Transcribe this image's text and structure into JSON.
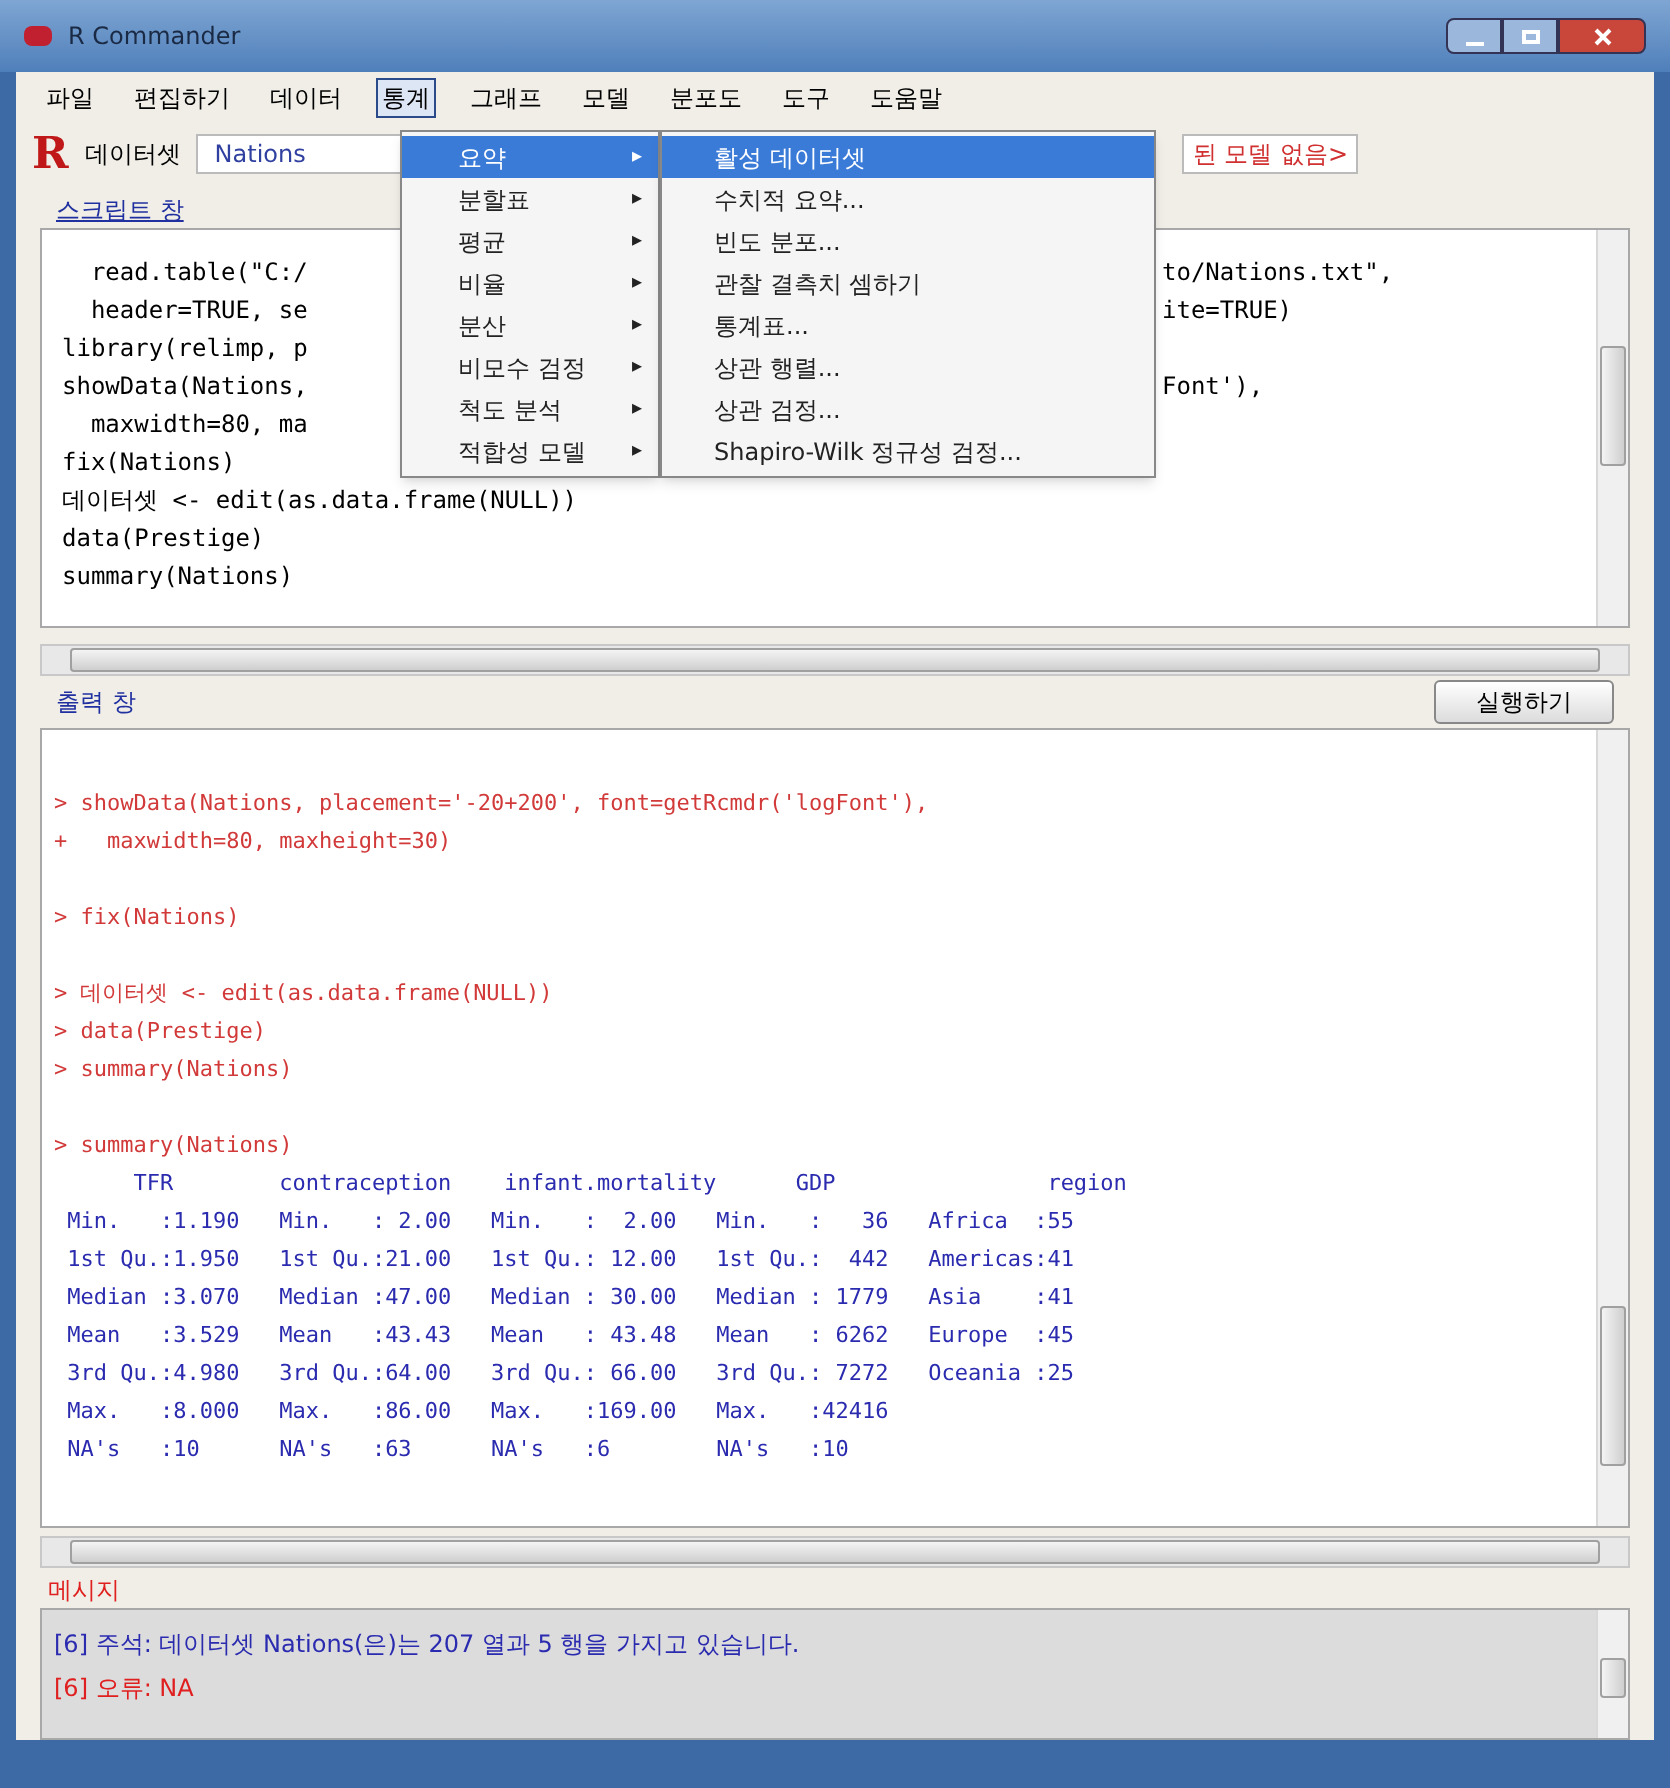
{
  "window": {
    "title": "R Commander"
  },
  "menubar": [
    {
      "label": "파일",
      "selected": false
    },
    {
      "label": "편집하기",
      "selected": false
    },
    {
      "label": "데이터",
      "selected": false
    },
    {
      "label": "통계",
      "selected": true
    },
    {
      "label": "그래프",
      "selected": false
    },
    {
      "label": "모델",
      "selected": false
    },
    {
      "label": "분포도",
      "selected": false
    },
    {
      "label": "도구",
      "selected": false
    },
    {
      "label": "도움말",
      "selected": false
    }
  ],
  "toolbar": {
    "logo": "R",
    "dataset_label": "데이터셋",
    "dataset": "Nations",
    "model": "된 모델 없음>"
  },
  "stats_menu": [
    {
      "label": "요약",
      "selected": true
    },
    {
      "label": "분할표",
      "selected": false
    },
    {
      "label": "평균",
      "selected": false
    },
    {
      "label": "비율",
      "selected": false
    },
    {
      "label": "분산",
      "selected": false
    },
    {
      "label": "비모수 검정",
      "selected": false
    },
    {
      "label": "척도 분석",
      "selected": false
    },
    {
      "label": "적합성 모델",
      "selected": false
    }
  ],
  "submenu_arrow": "▸",
  "summary_menu": [
    {
      "label": "활성 데이터셋",
      "selected": true
    },
    {
      "label": "수치적 요약...",
      "selected": false
    },
    {
      "label": "빈도 분포...",
      "selected": false
    },
    {
      "label": "관찰 결측치 셈하기",
      "selected": false
    },
    {
      "label": "통계표...",
      "selected": false
    },
    {
      "label": "상관 행렬...",
      "selected": false
    },
    {
      "label": "상관 검정...",
      "selected": false
    },
    {
      "label": "Shapiro-Wilk 정규성 검정...",
      "selected": false
    }
  ],
  "script": {
    "title": "스크립트 창",
    "lines": [
      {
        "text": "  read.table(\"C:/",
        "tail": "to/Nations.txt\","
      },
      {
        "text": "  header=TRUE, se",
        "tail": "ite=TRUE)"
      },
      {
        "text": "library(relimp, p"
      },
      {
        "text": "showData(Nations, ",
        "tail": "Font'),"
      },
      {
        "text": "  maxwidth=80, ma"
      },
      {
        "text": "fix(Nations)"
      },
      {
        "text": "데이터셋 <- edit(as.data.frame(NULL))"
      },
      {
        "text": "data(Prestige)"
      },
      {
        "text": "summary(Nations)"
      }
    ]
  },
  "output": {
    "title": "출력 창",
    "run_button": "실행하기",
    "lines": [
      {
        "kind": "blank"
      },
      {
        "kind": "command",
        "text": "> showData(Nations, placement='-20+200', font=getRcmdr('logFont'),"
      },
      {
        "kind": "command",
        "text": "+   maxwidth=80, maxheight=30)"
      },
      {
        "kind": "blank"
      },
      {
        "kind": "command",
        "text": "> fix(Nations)"
      },
      {
        "kind": "blank"
      },
      {
        "kind": "command",
        "text": "> 데이터셋 <- edit(as.data.frame(NULL))"
      },
      {
        "kind": "command",
        "text": "> data(Prestige)"
      },
      {
        "kind": "command",
        "text": "> summary(Nations)"
      },
      {
        "kind": "blank"
      },
      {
        "kind": "command",
        "text": "> summary(Nations)"
      },
      {
        "kind": "result",
        "text": "      TFR        contraception    infant.mortality      GDP                region"
      },
      {
        "kind": "result",
        "text": " Min.   :1.190   Min.   : 2.00   Min.   :  2.00   Min.   :   36   Africa  :55"
      },
      {
        "kind": "result",
        "text": " 1st Qu.:1.950   1st Qu.:21.00   1st Qu.: 12.00   1st Qu.:  442   Americas:41"
      },
      {
        "kind": "result",
        "text": " Median :3.070   Median :47.00   Median : 30.00   Median : 1779   Asia    :41"
      },
      {
        "kind": "result",
        "text": " Mean   :3.529   Mean   :43.43   Mean   : 43.48   Mean   : 6262   Europe  :45"
      },
      {
        "kind": "result",
        "text": " 3rd Qu.:4.980   3rd Qu.:64.00   3rd Qu.: 66.00   3rd Qu.: 7272   Oceania :25"
      },
      {
        "kind": "result",
        "text": " Max.   :8.000   Max.   :86.00   Max.   :169.00   Max.   :42416"
      },
      {
        "kind": "result",
        "text": " NA's   :10      NA's   :63      NA's   :6        NA's   :10"
      }
    ]
  },
  "messages": {
    "title": "메시지",
    "lines": [
      {
        "kind": "note",
        "text": "[6] 주석: 데이터셋 Nations(은)는 207 열과 5 행을 가지고 있습니다."
      },
      {
        "kind": "error",
        "text": "[6] 오류: NA"
      }
    ]
  }
}
